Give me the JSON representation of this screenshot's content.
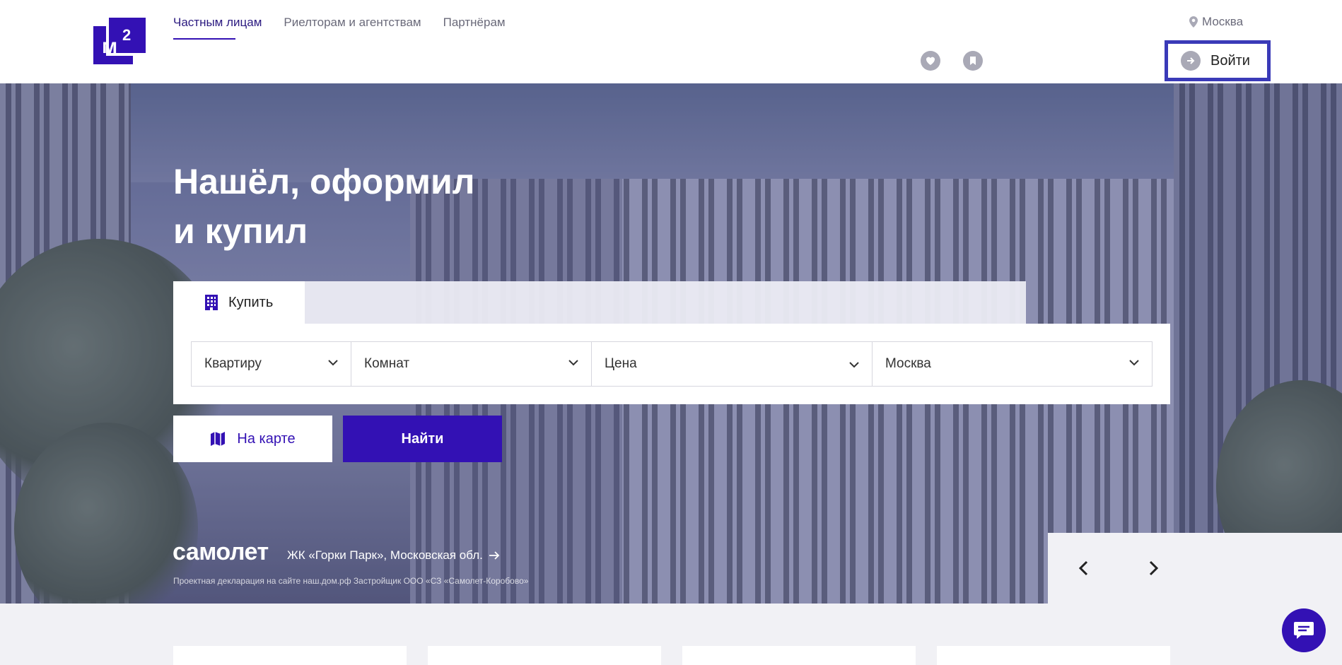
{
  "header": {
    "logo_text": "м",
    "logo_sup": "2",
    "nav": [
      "Частным лицам",
      "Риелторам и агентствам",
      "Партнёрам"
    ],
    "city": "Москва",
    "login_label": "Войти"
  },
  "hero": {
    "headline_line1": "Нашёл, оформил",
    "headline_line2": "и купил",
    "tab_buy": "Купить",
    "fields": {
      "type": "Квартиру",
      "rooms": "Комнат",
      "price": "Цена",
      "location": "Москва"
    },
    "map_button": "На карте",
    "find_button": "Найти",
    "brand": "самолет",
    "promo_text": "ЖК «Горки Парк», Московская обл.",
    "legal": "Проектная декларация на сайте наш.дом.рф Застройщик ООО «СЗ «Самолет-Коробово»"
  },
  "colors": {
    "brand": "#3311b4",
    "header_bg": "#ffffff",
    "page_bg": "#f1f1f5"
  }
}
